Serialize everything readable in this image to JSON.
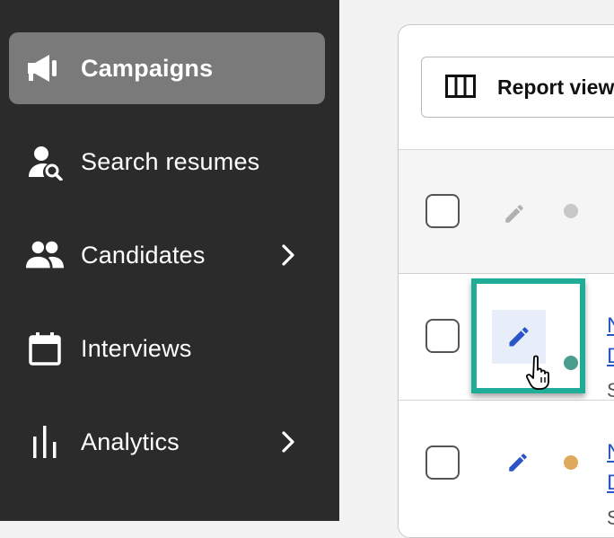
{
  "sidebar": {
    "items": [
      {
        "label": "Campaigns",
        "icon": "megaphone-icon",
        "active": true,
        "has_submenu": false
      },
      {
        "label": "Search resumes",
        "icon": "person-search-icon",
        "active": false,
        "has_submenu": false
      },
      {
        "label": "Candidates",
        "icon": "people-icon",
        "active": false,
        "has_submenu": true
      },
      {
        "label": "Interviews",
        "icon": "calendar-icon",
        "active": false,
        "has_submenu": false
      },
      {
        "label": "Analytics",
        "icon": "bar-chart-icon",
        "active": false,
        "has_submenu": true
      }
    ]
  },
  "main": {
    "report_view_label": "Report view",
    "rows": [
      {
        "status_color": "#4a9e8e",
        "title_fragment": "N",
        "title_fragment2": "D",
        "sub_fragment": "S"
      },
      {
        "status_color": "#e0a85a",
        "title_fragment": "N",
        "title_fragment2": "D",
        "sub_fragment": "S"
      }
    ]
  },
  "colors": {
    "sidebar_bg": "#2b2b2b",
    "active_item_bg": "#7a7a7a",
    "highlight": "#1fad97",
    "edit_icon": "#2a55c8"
  }
}
